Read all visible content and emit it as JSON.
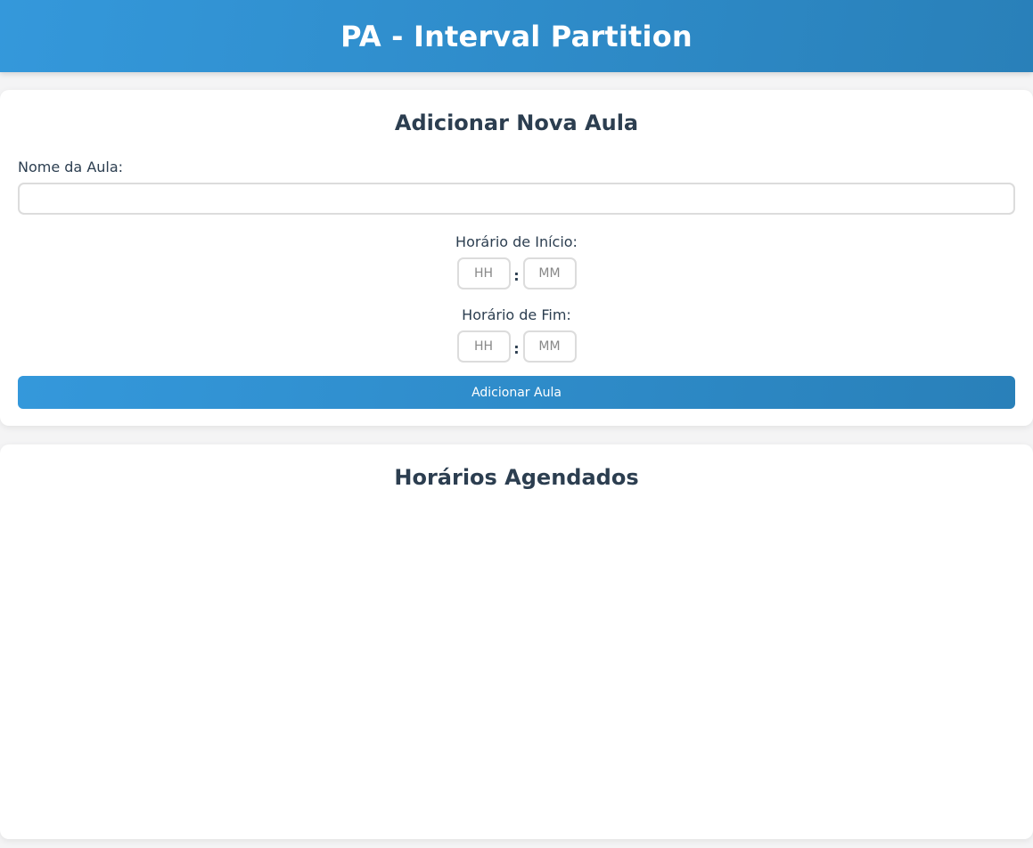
{
  "header": {
    "title": "PA - Interval Partition"
  },
  "form": {
    "title": "Adicionar Nova Aula",
    "name_label": "Nome da Aula:",
    "name_value": "",
    "name_placeholder": "",
    "start": {
      "label": "Horário de Início:",
      "hour_placeholder": "HH",
      "minute_placeholder": "MM",
      "separator": ":"
    },
    "end": {
      "label": "Horário de Fim:",
      "hour_placeholder": "HH",
      "minute_placeholder": "MM",
      "separator": ":"
    },
    "submit_label": "Adicionar Aula"
  },
  "schedule": {
    "title": "Horários Agendados",
    "items": []
  },
  "colors": {
    "accent": "#3498db",
    "accent_dark": "#2980b9",
    "text": "#2c3e50",
    "background": "#f4f4f5"
  }
}
